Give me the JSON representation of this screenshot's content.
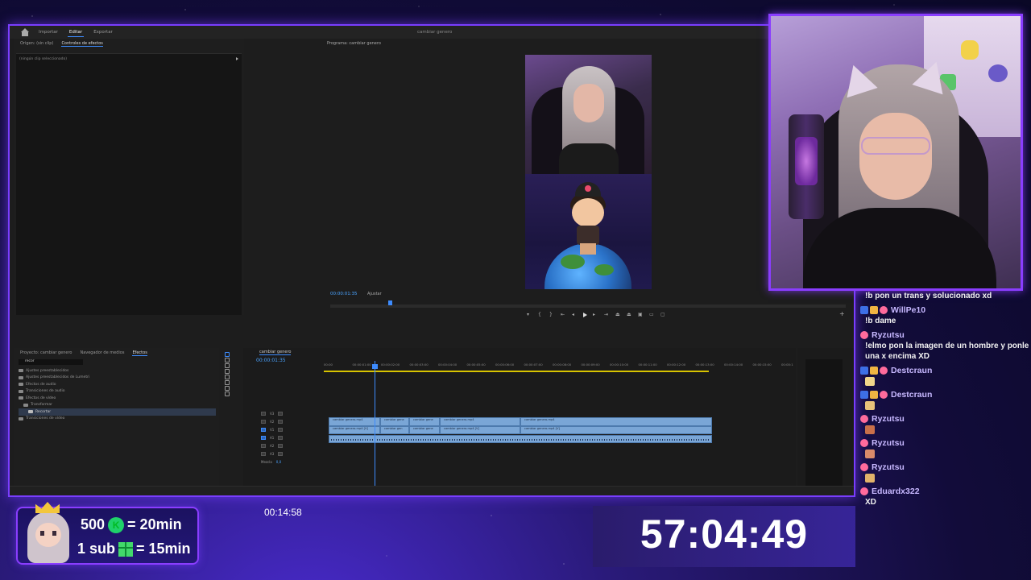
{
  "premiere": {
    "tabs": [
      "Importar",
      "Editar",
      "Exportar"
    ],
    "active_tab": "Editar",
    "app_title": "cambiar genero",
    "source_panel": {
      "tabs": [
        "Origen: (sin clip)",
        "Controles de efectos"
      ],
      "empty_text": "(ningún clip seleccionado)"
    },
    "program": {
      "title": "Programa: cambiar genero",
      "timecode": "00:00:01:35",
      "fit": "Ajustar"
    },
    "project_panel": {
      "tabs": [
        "Proyecto: cambiar genero",
        "Navegador de medios",
        "Efectos"
      ],
      "search_value": "recor",
      "effects": [
        "Ajustes preestablecidos",
        "Ajustes preestablecidos de Lumetri",
        "Efectos de audio",
        "Transiciones de audio",
        "Efectos de vídeo",
        "Transformar",
        "Recortar",
        "Transiciones de vídeo"
      ]
    },
    "timeline": {
      "tab": "cambiar genero",
      "timecode": "00:00:01:35",
      "ruler": [
        "00:00",
        "00:00:01:00",
        "00:00:02:00",
        "00:00:03:00",
        "00:00:04:00",
        "00:00:05:00",
        "00:00:06:00",
        "00:00:07:00",
        "00:00:08:00",
        "00:00:09:00",
        "00:00:10:00",
        "00:00:11:00",
        "00:00:12:00",
        "00:00:13:00",
        "00:00:14:00",
        "00:00:15:00",
        "00:00:1"
      ],
      "tracks": [
        "V3",
        "V2",
        "V1",
        "A1",
        "A2",
        "A3",
        "Mezcla"
      ],
      "mix_value": "0,0",
      "v2_clips": [
        "cambiar genero.mp4",
        "cambiar gene",
        "cambiar gene",
        "cambiar genero.mp4",
        "cambiar genero.mp4"
      ],
      "v1_clips": [
        "cambiar genero.mp4 [V]",
        "cambiar gen",
        "cambiar gene",
        "cambiar genero.mp4 [V]",
        "cambiar genero.mp4 [V]"
      ]
    }
  },
  "chat": {
    "messages": [
      {
        "user": "",
        "text": "!b pon un trans y solucionado xd"
      },
      {
        "user": "WillPe10",
        "badge": "blue",
        "text": "!b dame"
      },
      {
        "user": "Ryzutsu",
        "badge": "pink",
        "text": "!elmo pon la imagen de un hombre y ponle una x encima XD"
      },
      {
        "user": "Destcraun",
        "badge": "blue",
        "text": "",
        "emote": true
      },
      {
        "user": "Destcraun",
        "badge": "blue",
        "text": "",
        "emote": true
      },
      {
        "user": "Ryzutsu",
        "badge": "pink",
        "text": "",
        "emote": true
      },
      {
        "user": "Ryzutsu",
        "badge": "pink",
        "text": "",
        "emote": true
      },
      {
        "user": "Ryzutsu",
        "badge": "pink",
        "text": "",
        "emote": true
      },
      {
        "user": "Eduardx322",
        "badge": "pink",
        "text": "XD"
      }
    ]
  },
  "overlay": {
    "sub_line_1": {
      "amount": "500",
      "reward": "= 20min"
    },
    "sub_line_2": {
      "amount": "1 sub",
      "reward": "= 15min"
    },
    "clock": "00:14:58",
    "subathon_timer": "57:04:49"
  },
  "colors": {
    "accent": "#8a3dff",
    "premiere_blue": "#3d8bfd",
    "clip_blue": "#7aa6d6"
  }
}
